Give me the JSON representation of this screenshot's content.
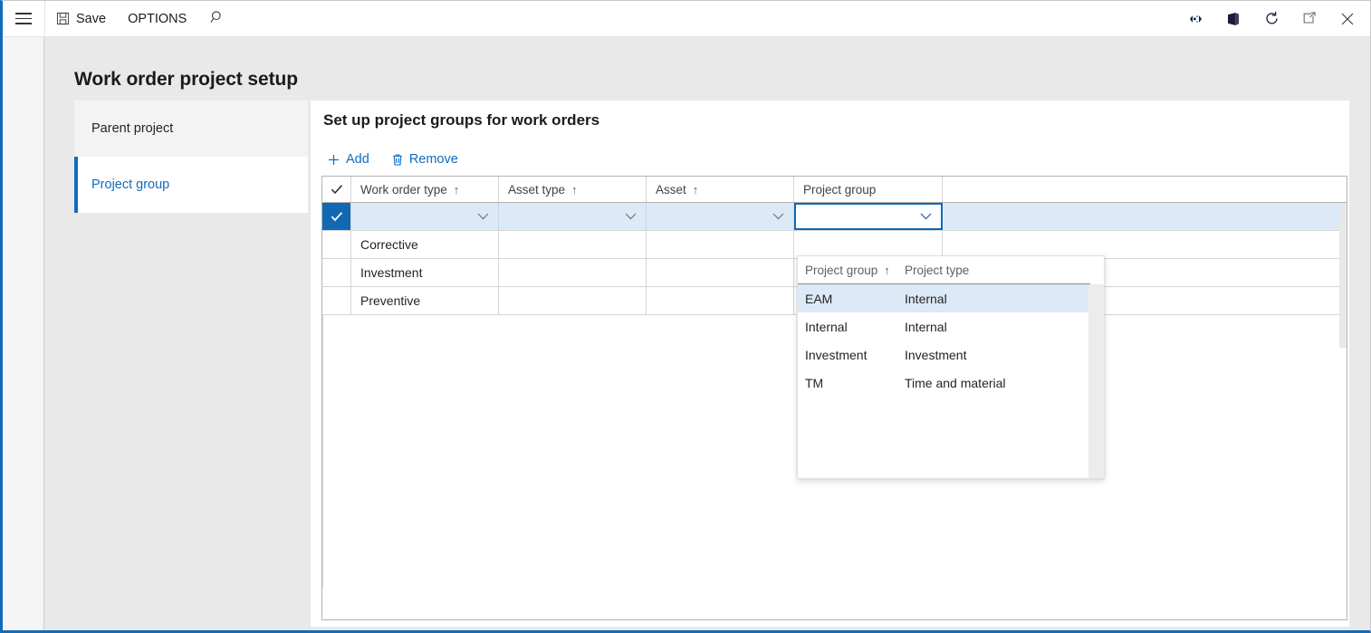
{
  "topbar": {
    "menu_icon": "hamburger-icon",
    "save_label": "Save",
    "save_icon": "save-floppy-icon",
    "options_label": "OPTIONS",
    "search_icon": "search-icon",
    "right_icons": [
      {
        "name": "dynamics-settings-icon",
        "title": "Settings"
      },
      {
        "name": "office-module-icon",
        "title": "Office"
      },
      {
        "name": "refresh-icon",
        "title": "Refresh"
      },
      {
        "name": "restore-window-icon",
        "title": "Restore"
      },
      {
        "name": "close-window-icon",
        "title": "Close"
      }
    ]
  },
  "page": {
    "title": "Work order project setup"
  },
  "tabs": [
    {
      "label": "Parent project",
      "active": false
    },
    {
      "label": "Project group",
      "active": true
    }
  ],
  "card": {
    "title": "Set up project groups for work orders",
    "toolbar": [
      {
        "label": "Add",
        "icon": "plus-icon"
      },
      {
        "label": "Remove",
        "icon": "trash-icon"
      }
    ]
  },
  "grid": {
    "select_all_icon": "checkmark-icon",
    "columns": [
      {
        "label": "Work order type",
        "sorted": true,
        "sort_dir": "↑"
      },
      {
        "label": "Asset type",
        "sorted": true,
        "sort_dir": "↑"
      },
      {
        "label": "Asset",
        "sorted": true,
        "sort_dir": "↑"
      },
      {
        "label": "Project group",
        "sorted": false,
        "sort_dir": ""
      }
    ],
    "new_row": {
      "selected": true,
      "check_icon": "checkmark-icon",
      "work_order_type": "",
      "asset_type": "",
      "asset": "",
      "project_group": "",
      "dropdown_icon": "chevron-down-icon"
    },
    "rows": [
      {
        "work_order_type": "Corrective",
        "asset_type": "",
        "asset": "",
        "project_group": ""
      },
      {
        "work_order_type": "Investment",
        "asset_type": "",
        "asset": "",
        "project_group": ""
      },
      {
        "work_order_type": "Preventive",
        "asset_type": "",
        "asset": "",
        "project_group": ""
      }
    ]
  },
  "lookup": {
    "columns": [
      {
        "label": "Project group",
        "sorted": true,
        "sort_dir": "↑"
      },
      {
        "label": "Project type",
        "sorted": false,
        "sort_dir": ""
      }
    ],
    "rows": [
      {
        "project_group": "EAM",
        "project_type": "Internal",
        "highlighted": true
      },
      {
        "project_group": "Internal",
        "project_type": "Internal",
        "highlighted": false
      },
      {
        "project_group": "Investment",
        "project_type": "Investment",
        "highlighted": false
      },
      {
        "project_group": "TM",
        "project_type": "Time and material",
        "highlighted": false
      }
    ]
  },
  "colors": {
    "accent": "#0f6cbd",
    "selected_row_fill": "#dceaf7",
    "selected_check_fill": "#1268b3",
    "page_background": "#e9e9e9"
  }
}
